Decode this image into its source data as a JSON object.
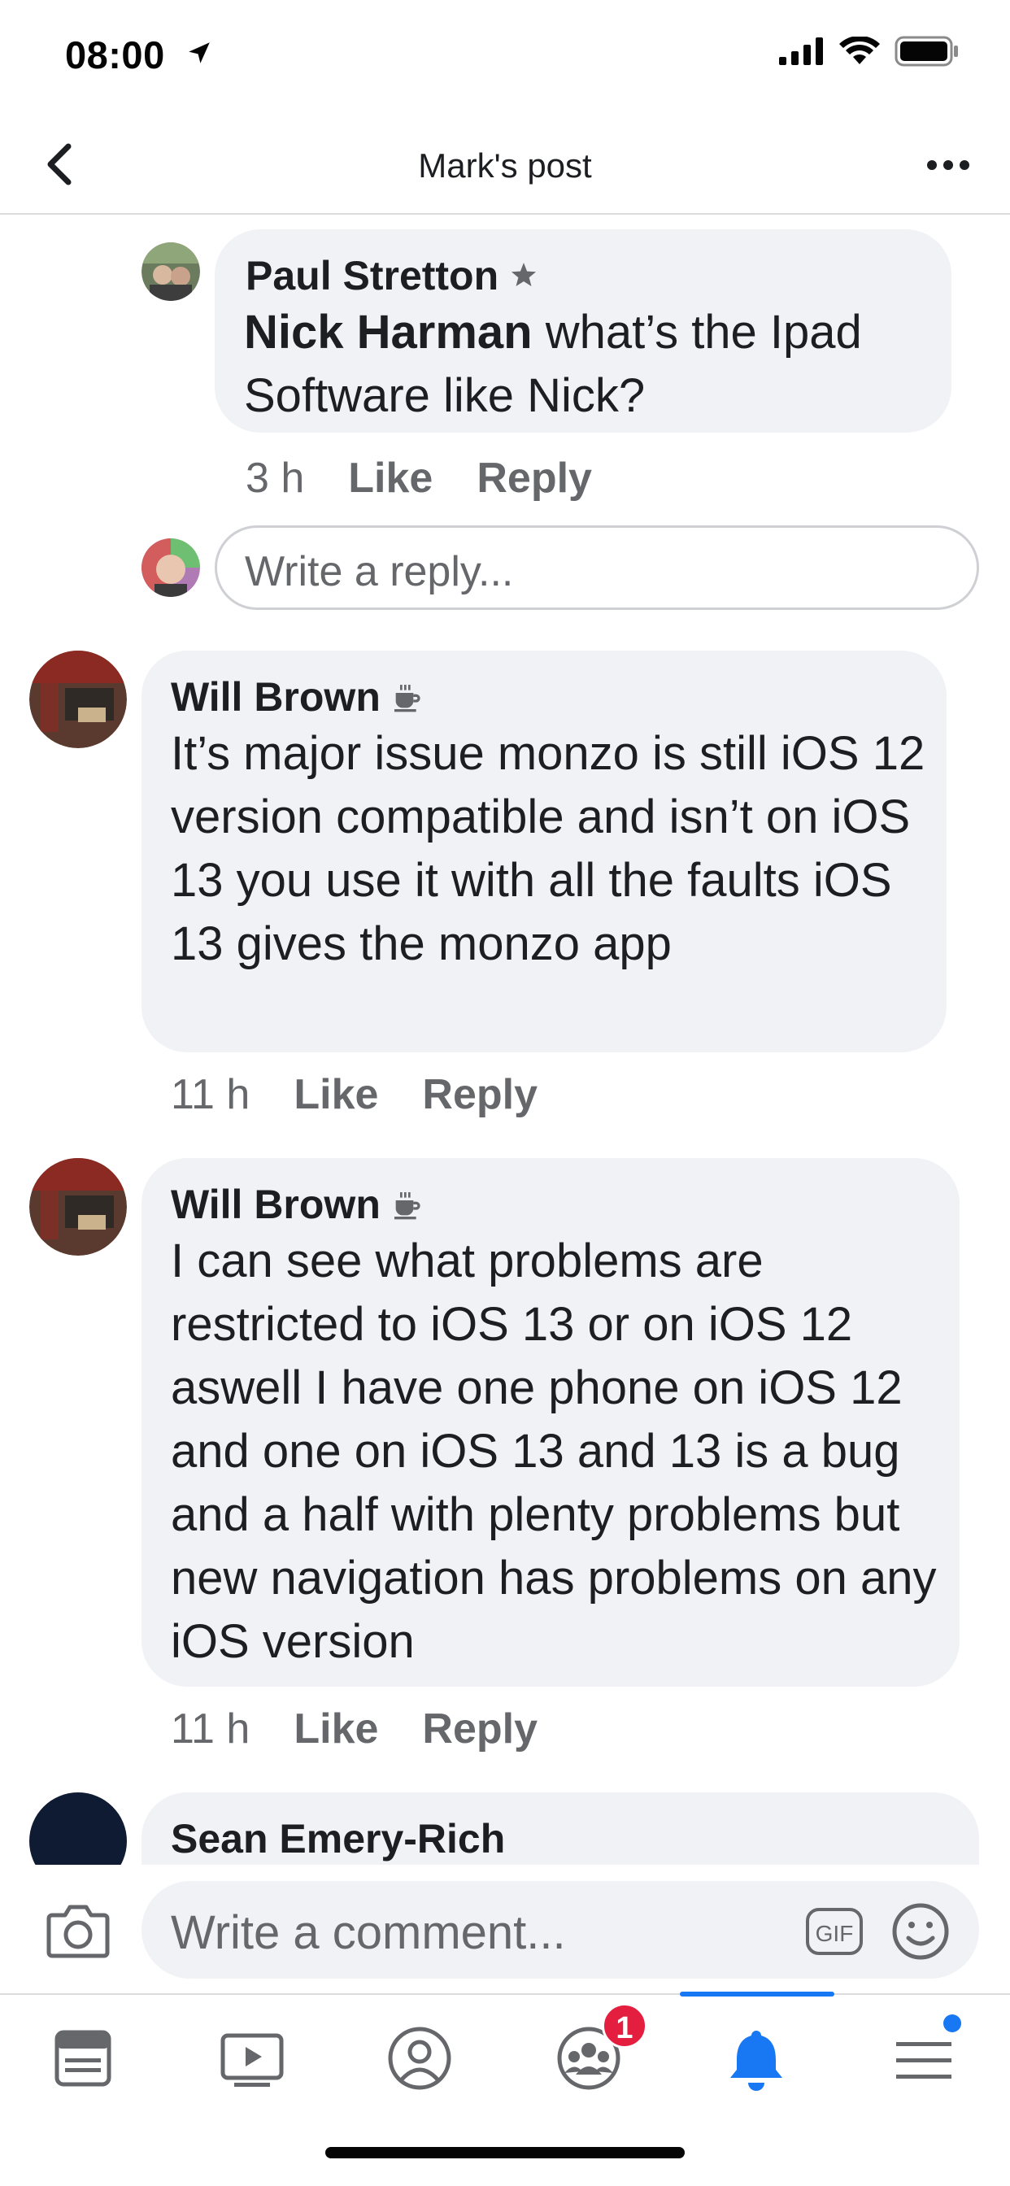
{
  "status_bar": {
    "time": "08:00"
  },
  "header": {
    "title": "Mark's post"
  },
  "comments": [
    {
      "author": "Paul Stretton",
      "mention": "Nick Harman",
      "text": " what’s the Ipad Software like Nick?",
      "time": "3 h",
      "like": "Like",
      "reply": "Reply",
      "badge_icon": "star-badge-icon"
    },
    {
      "author": "Will Brown",
      "text": "It’s major issue monzo is still iOS 12 version compatible and isn’t on iOS 13 you use it with all the faults iOS 13 gives the monzo app",
      "time": "11 h",
      "like": "Like",
      "reply": "Reply",
      "badge_icon": "coffee-badge-icon"
    },
    {
      "author": "Will Brown",
      "text": "I can see what problems are restricted to iOS 13 or on iOS 12 aswell I have one phone on iOS 12 and one on iOS 13 and 13 is a bug and a half with plenty problems but new navigation has problems on any iOS version",
      "time": "11 h",
      "like": "Like",
      "reply": "Reply",
      "badge_icon": "coffee-badge-icon"
    },
    {
      "author": "Sean Emery-Rich"
    }
  ],
  "reply_input": {
    "placeholder": "Write a reply..."
  },
  "composer": {
    "placeholder": "Write a comment...",
    "gif_label": "GIF"
  },
  "tabbar": {
    "tabs": [
      "news-feed-tab",
      "watch-tab",
      "profile-tab",
      "groups-tab",
      "notifications-tab",
      "menu-tab"
    ],
    "groups_badge": "1",
    "active_tab": "notifications-tab"
  },
  "colors": {
    "accent": "#1877f2",
    "bubble": "#f0f2f5",
    "badge": "#e41e3f",
    "meta": "#65676b"
  }
}
